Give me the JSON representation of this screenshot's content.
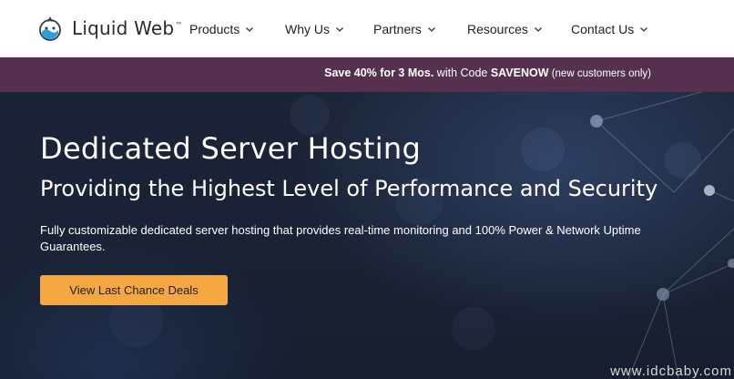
{
  "header": {
    "logo_text": "Liquid Web",
    "logo_tm": "™",
    "nav": [
      {
        "label": "Products",
        "icon": "chevron-down-icon"
      },
      {
        "label": "Why Us",
        "icon": "chevron-down-icon"
      },
      {
        "label": "Partners",
        "icon": "chevron-down-icon"
      },
      {
        "label": "Resources",
        "icon": "chevron-down-icon"
      },
      {
        "label": "Contact Us",
        "icon": "chevron-down-icon"
      }
    ]
  },
  "promo": {
    "part1": "Save 40% for 3 Mos.",
    "part2": " with Code ",
    "code": "SAVENOW",
    "part3": " (new customers only)",
    "background": "#55314f"
  },
  "hero": {
    "title": "Dedicated Server Hosting",
    "subtitle": "Providing the Highest Level of Performance and Security",
    "description": "Fully customizable dedicated server hosting that provides real-time monitoring and 100% Power & Network Uptime Guarantees.",
    "cta_label": "View Last Chance Deals",
    "cta_color": "#f5a741"
  },
  "watermark": "www.idcbaby.com"
}
